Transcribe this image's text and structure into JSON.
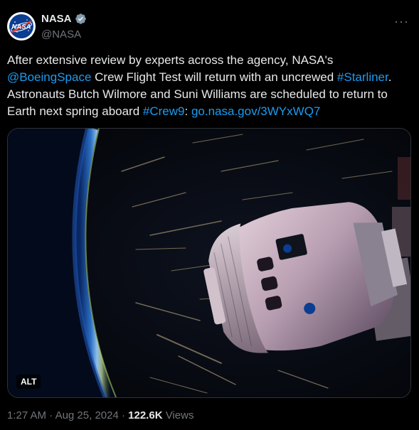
{
  "author": {
    "name": "NASA",
    "handle": "@NASA",
    "avatar_icon": "nasa-meatball-logo",
    "verified_icon": "verified-badge-icon",
    "verified_color": "#829aab"
  },
  "more_icon": "more-options-icon",
  "tweet": {
    "segments": [
      {
        "text": "After extensive review by experts across the agency, NASA's ",
        "type": "text"
      },
      {
        "text": "@BoeingSpace",
        "type": "mention"
      },
      {
        "text": " Crew Flight Test will return with an uncrewed ",
        "type": "text"
      },
      {
        "text": "#Starliner",
        "type": "hashtag"
      },
      {
        "text": ". Astronauts Butch Wilmore and Suni Williams are scheduled to return to Earth next spring aboard ",
        "type": "text"
      },
      {
        "text": "#Crew9",
        "type": "hashtag"
      },
      {
        "text": ": ",
        "type": "text"
      },
      {
        "text": "go.nasa.gov/3WYxWQ7",
        "type": "link"
      }
    ]
  },
  "media": {
    "alt_label": "ALT"
  },
  "meta": {
    "time": "1:27 AM",
    "separator": "·",
    "date": "Aug 25, 2024",
    "views_count": "122.6K",
    "views_label": "Views"
  },
  "colors": {
    "link": "#1d9bf0",
    "text": "#e7e9ea",
    "muted": "#71767b",
    "background": "#000000"
  }
}
